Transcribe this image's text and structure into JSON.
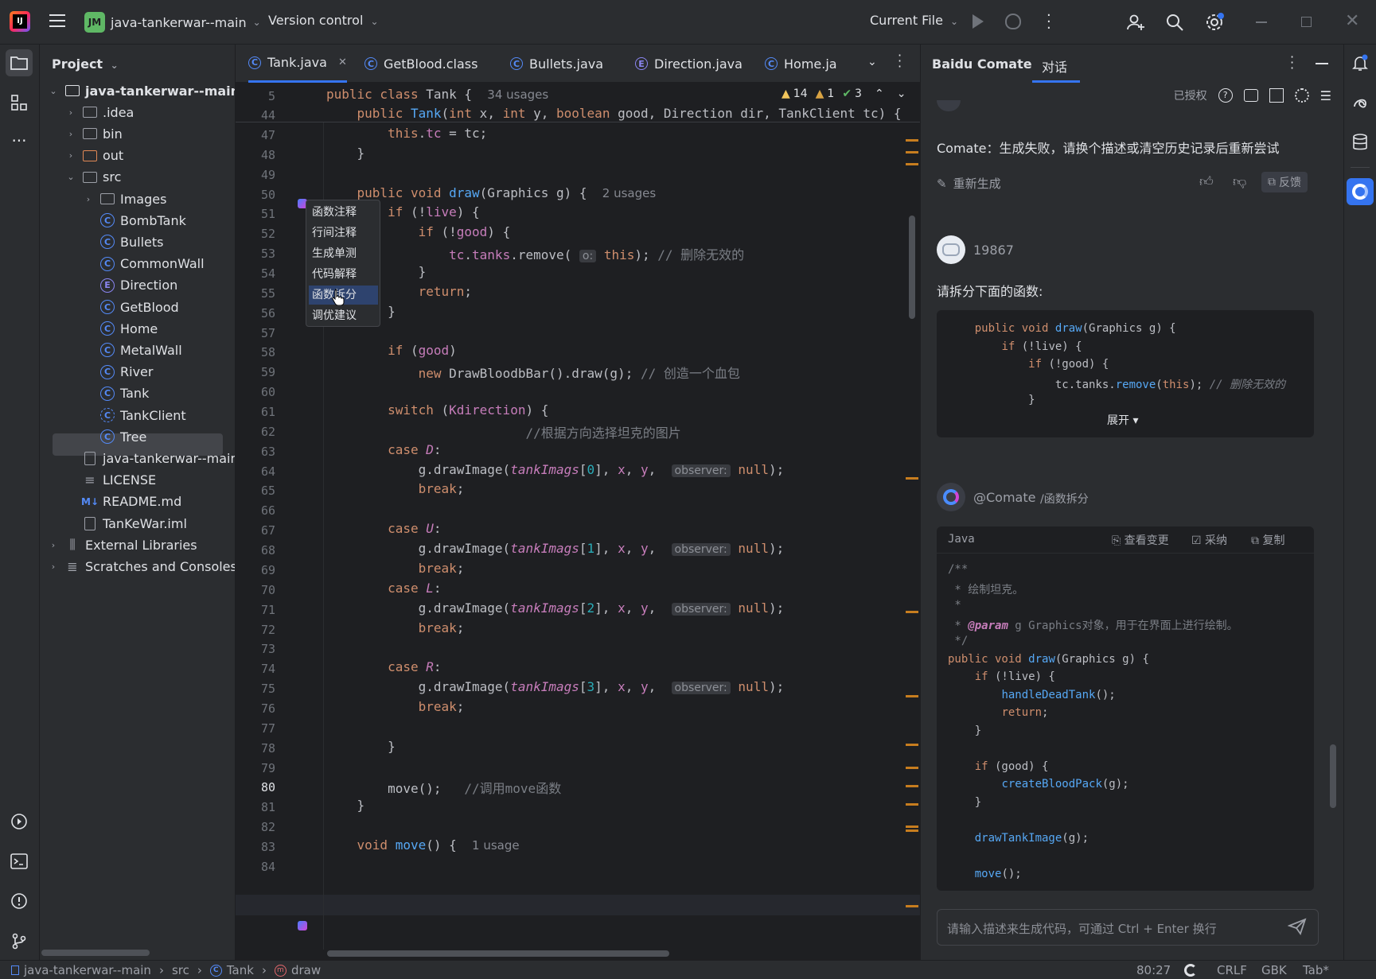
{
  "titlebar": {
    "project_badge": "JM",
    "project_name": "java-tankerwar--main",
    "version_control": "Version control",
    "run_config": "Current File"
  },
  "project_panel": {
    "title": "Project",
    "items": [
      {
        "label": "java-tankerwar--main",
        "icon": "module-folder-icon",
        "level": 0,
        "expanded": true
      },
      {
        "label": ".idea",
        "icon": "folder-icon",
        "level": 1
      },
      {
        "label": "bin",
        "icon": "folder-icon",
        "level": 1
      },
      {
        "label": "out",
        "icon": "folder-orange-icon",
        "level": 1
      },
      {
        "label": "src",
        "icon": "folder-icon",
        "level": 1,
        "expanded": true
      },
      {
        "label": "Images",
        "icon": "package-icon",
        "level": 2
      },
      {
        "label": "BombTank",
        "icon": "class-icon",
        "level": 2
      },
      {
        "label": "Bullets",
        "icon": "class-icon",
        "level": 2
      },
      {
        "label": "CommonWall",
        "icon": "class-icon",
        "level": 2
      },
      {
        "label": "Direction",
        "icon": "enum-icon",
        "level": 2
      },
      {
        "label": "GetBlood",
        "icon": "class-icon",
        "level": 2
      },
      {
        "label": "Home",
        "icon": "class-icon",
        "level": 2
      },
      {
        "label": "MetalWall",
        "icon": "class-icon",
        "level": 2
      },
      {
        "label": "River",
        "icon": "class-icon",
        "level": 2
      },
      {
        "label": "Tank",
        "icon": "class-icon",
        "level": 2,
        "selected": true
      },
      {
        "label": "TankClient",
        "icon": "class-runnable-icon",
        "level": 2
      },
      {
        "label": "Tree",
        "icon": "class-icon",
        "level": 2
      },
      {
        "label": "java-tankerwar--main.",
        "icon": "file-icon",
        "level": 1
      },
      {
        "label": "LICENSE",
        "icon": "text-file-icon",
        "level": 1
      },
      {
        "label": "README.md",
        "icon": "markdown-icon",
        "level": 1
      },
      {
        "label": "TanKeWar.iml",
        "icon": "file-icon",
        "level": 1
      },
      {
        "label": "External Libraries",
        "icon": "library-icon",
        "level": 0
      },
      {
        "label": "Scratches and Consoles",
        "icon": "scratches-icon",
        "level": 0
      }
    ]
  },
  "tabs": [
    {
      "label": "Tank.java",
      "icon": "class-icon",
      "active": true
    },
    {
      "label": "GetBlood.class",
      "icon": "class-icon"
    },
    {
      "label": "Bullets.java",
      "icon": "class-icon"
    },
    {
      "label": "Direction.java",
      "icon": "enum-icon"
    },
    {
      "label": "Home.ja",
      "icon": "class-icon"
    }
  ],
  "editor": {
    "inspections": {
      "warnings": "14",
      "weak_warnings": "1",
      "ok": "3"
    },
    "sticky_lines": [
      {
        "num": "5",
        "html": "<span class=\"kw\">public class</span> Tank {  <span class=\"hint\">34 usages</span>"
      },
      {
        "num": "44",
        "html": "    <span class=\"kw\">public</span> <span class=\"fn\">Tank</span>(<span class=\"kw\">int</span> x, <span class=\"kw\">int</span> y, <span class=\"kw\">boolean</span> good, Direction dir, TankClient tc) {"
      }
    ],
    "lines": [
      {
        "num": "47",
        "html": "        <span class=\"kw\">this</span>.<span class=\"fld\">tc</span> = tc;"
      },
      {
        "num": "48",
        "html": "    }"
      },
      {
        "num": "49",
        "html": ""
      },
      {
        "num": "50",
        "html": "    <span class=\"kw\">public void</span> <span class=\"fn\">draw</span>(Graphics g) {  <span class=\"hint\">2 usages</span>"
      },
      {
        "num": "51",
        "html": "        <span class=\"kw\">if</span> (!<span class=\"fld\">live</span>) {"
      },
      {
        "num": "52",
        "html": "            <span class=\"kw\">if</span> (!<span class=\"fld\">good</span>) {"
      },
      {
        "num": "53",
        "html": "                <span class=\"fld\">tc</span>.<span class=\"fld\">tanks</span>.remove( <span class=\"inlay\">o:</span> <span class=\"kw\">this</span>); <span class=\"cm\">// 删除无效的</span>"
      },
      {
        "num": "54",
        "html": "            }"
      },
      {
        "num": "55",
        "html": "            <span class=\"kw\">return</span>;"
      },
      {
        "num": "56",
        "html": "        }"
      },
      {
        "num": "57",
        "html": ""
      },
      {
        "num": "58",
        "html": "        <span class=\"kw\">if</span> (<span class=\"fld\">good</span>)"
      },
      {
        "num": "59",
        "html": "            <span class=\"kw\">new</span> DrawBloodbBar().draw(g); <span class=\"cm\">// 创造一个血包</span>"
      },
      {
        "num": "60",
        "html": ""
      },
      {
        "num": "61",
        "html": "        <span class=\"kw\">switch</span> (<span class=\"fld\">Kdirection</span>) {"
      },
      {
        "num": "62",
        "html": "                          <span class=\"cm\">//根据方向选择坦克的图片</span>"
      },
      {
        "num": "63",
        "html": "        <span class=\"kw\">case</span> <span class=\"it\">D</span>:"
      },
      {
        "num": "64",
        "html": "            g.drawImage(<span class=\"it\">tankImags</span>[<span class=\"num\">0</span>], <span class=\"fld\">x</span>, <span class=\"fld\">y</span>,  <span class=\"inlay\">observer:</span> <span class=\"kw\">null</span>);"
      },
      {
        "num": "65",
        "html": "            <span class=\"kw\">break</span>;"
      },
      {
        "num": "66",
        "html": ""
      },
      {
        "num": "67",
        "html": "        <span class=\"kw\">case</span> <span class=\"it\">U</span>:"
      },
      {
        "num": "68",
        "html": "            g.drawImage(<span class=\"it\">tankImags</span>[<span class=\"num\">1</span>], <span class=\"fld\">x</span>, <span class=\"fld\">y</span>,  <span class=\"inlay\">observer:</span> <span class=\"kw\">null</span>);"
      },
      {
        "num": "69",
        "html": "            <span class=\"kw\">break</span>;"
      },
      {
        "num": "70",
        "html": "        <span class=\"kw\">case</span> <span class=\"it\">L</span>:"
      },
      {
        "num": "71",
        "html": "            g.drawImage(<span class=\"it\">tankImags</span>[<span class=\"num\">2</span>], <span class=\"fld\">x</span>, <span class=\"fld\">y</span>,  <span class=\"inlay\">observer:</span> <span class=\"kw\">null</span>);"
      },
      {
        "num": "72",
        "html": "            <span class=\"kw\">break</span>;"
      },
      {
        "num": "73",
        "html": ""
      },
      {
        "num": "74",
        "html": "        <span class=\"kw\">case</span> <span class=\"it\">R</span>:"
      },
      {
        "num": "75",
        "html": "            g.drawImage(<span class=\"it\">tankImags</span>[<span class=\"num\">3</span>], <span class=\"fld\">x</span>, <span class=\"fld\">y</span>,  <span class=\"inlay\">observer:</span> <span class=\"kw\">null</span>);"
      },
      {
        "num": "76",
        "html": "            <span class=\"kw\">break</span>;"
      },
      {
        "num": "77",
        "html": ""
      },
      {
        "num": "78",
        "html": "        }"
      },
      {
        "num": "79",
        "html": ""
      },
      {
        "num": "80",
        "html": "        move();   <span class=\"cm\">//调用move函数</span>",
        "current": true
      },
      {
        "num": "81",
        "html": "    }"
      },
      {
        "num": "82",
        "html": ""
      },
      {
        "num": "83",
        "html": "    <span class=\"kw\">void</span> <span class=\"fn\">move</span>() {  <span class=\"hint\">1 usage</span>"
      },
      {
        "num": "84",
        "html": ""
      }
    ]
  },
  "context_popup": {
    "items": [
      "函数注释",
      "行间注释",
      "生成单测",
      "代码解释",
      "函数拆分",
      "调优建议"
    ],
    "selected_index": 4
  },
  "comate": {
    "title": "Baidu Comate",
    "tab": "对话",
    "authorized": "已授权",
    "error_message": "Comate：生成失败，请换个描述或清空历史记录后重新尝试",
    "regenerate": "重新生成",
    "feedback": "反馈",
    "user_name": "19867",
    "user_prompt": "请拆分下面的函数:",
    "user_code": [
      "    public void draw(Graphics g) {",
      "        if (!live) {",
      "            if (!good) {",
      "                tc.tanks.remove(this); // 删除无效的",
      "            }"
    ],
    "expand_label": "展开 ▾",
    "bot_name": "@Comate",
    "bot_command": "/函数拆分",
    "answer_lang": "Java",
    "view_changes": "查看变更",
    "accept": "采纳",
    "copy": "复制",
    "answer_code": [
      {
        "html": "<span class=\"cm\">/**</span>"
      },
      {
        "html": "<span class=\"cm\"> * 绘制坦克。</span>"
      },
      {
        "html": "<span class=\"cm\"> *</span>"
      },
      {
        "html": "<span class=\"cm\"> * </span><span style=\"color:#c77dbb;font-style:italic;font-weight:bold\">@param</span><span class=\"cm\"> g Graphics对象，用于在界面上进行绘制。</span>"
      },
      {
        "html": "<span class=\"cm\"> */</span>"
      },
      {
        "html": "<span class=\"kw\">public void</span> <span class=\"fn\">draw</span>(Graphics g) {"
      },
      {
        "html": "    <span class=\"kw\">if</span> (!live) {"
      },
      {
        "html": "        <span class=\"fn\">handleDeadTank</span>();"
      },
      {
        "html": "        <span class=\"kw\">return</span>;"
      },
      {
        "html": "    }"
      },
      {
        "html": ""
      },
      {
        "html": "    <span class=\"kw\">if</span> (good) {"
      },
      {
        "html": "        <span class=\"fn\">createBloodPack</span>(g);"
      },
      {
        "html": "    }"
      },
      {
        "html": ""
      },
      {
        "html": "    <span class=\"fn\">drawTankImage</span>(g);"
      },
      {
        "html": ""
      },
      {
        "html": "    <span class=\"fn\">move</span>();"
      }
    ],
    "input_placeholder": "请输入描述来生成代码，可通过 Ctrl + Enter 换行"
  },
  "statusbar": {
    "breadcrumb": [
      "java-tankerwar--main",
      "src",
      "Tank",
      "draw"
    ],
    "position": "80:27",
    "line_sep": "CRLF",
    "encoding": "GBK",
    "indent": "Tab*"
  }
}
